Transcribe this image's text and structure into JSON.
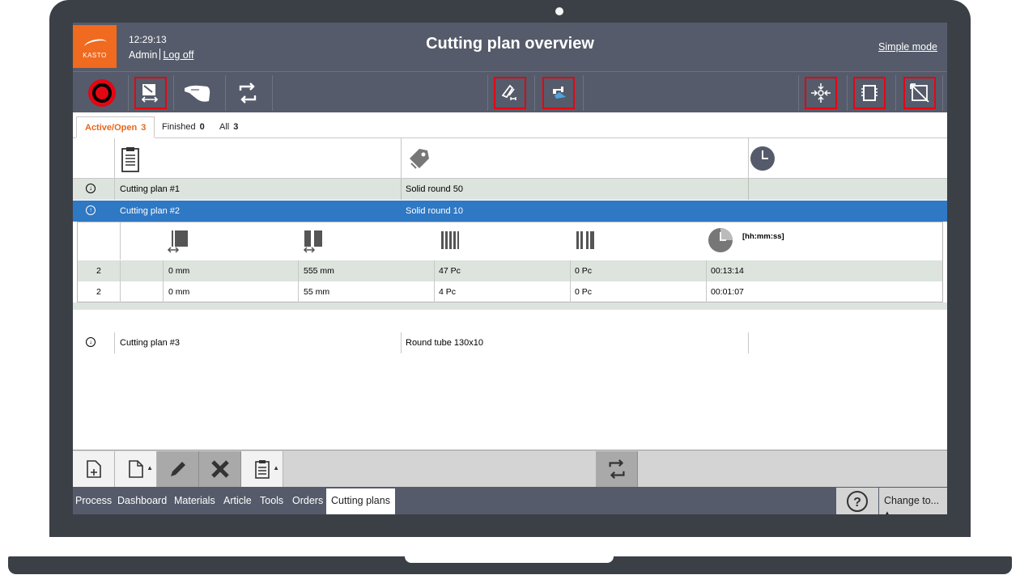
{
  "header": {
    "brand": "KASTO",
    "time": "12:29:13",
    "user": "Admin",
    "logoff": "Log off",
    "title": "Cutting plan overview",
    "simple_mode": "Simple mode"
  },
  "tabs": [
    {
      "label": "Active/Open",
      "count": "3"
    },
    {
      "label": "Finished",
      "count": "0"
    },
    {
      "label": "All",
      "count": "3"
    }
  ],
  "plans": [
    {
      "name": "Cutting plan #1",
      "material": "Solid round 50",
      "expand": "↓"
    },
    {
      "name": "Cutting plan #2",
      "material": "Solid round 10",
      "expand": "↑"
    },
    {
      "name": "Cutting plan #3",
      "material": "Round tube 130x10",
      "expand": "↓"
    }
  ],
  "details": {
    "time_format": "[hh:mm:ss]",
    "rows": [
      {
        "qty": "2",
        "c1": "0 mm",
        "c2": "555 mm",
        "c3": "47 Pc",
        "c4": "0 Pc",
        "time": "00:13:14"
      },
      {
        "qty": "2",
        "c1": "0 mm",
        "c2": "55 mm",
        "c3": "4 Pc",
        "c4": "0 Pc",
        "time": "00:01:07"
      }
    ]
  },
  "nav": {
    "items": [
      "Process",
      "Dashboard",
      "Materials",
      "Article",
      "Tools",
      "Orders",
      "Cutting plans"
    ],
    "change_to": "Change to..."
  },
  "icons": {
    "toolbar": [
      "stop-icon",
      "cut-length-icon",
      "hand-icon",
      "cycle-icon",
      "saw-settings-icon",
      "coolant-icon",
      "center-icon",
      "copy-plan-icon",
      "resize-icon"
    ],
    "actions": [
      "new-document-icon",
      "document-icon",
      "pencil-icon",
      "delete-icon",
      "clipboard-icon",
      "refresh-icon"
    ]
  },
  "colors": {
    "accent": "#f06a1f",
    "selection": "#2f78c4",
    "header": "#555b6a",
    "highlight": "#e30613"
  }
}
